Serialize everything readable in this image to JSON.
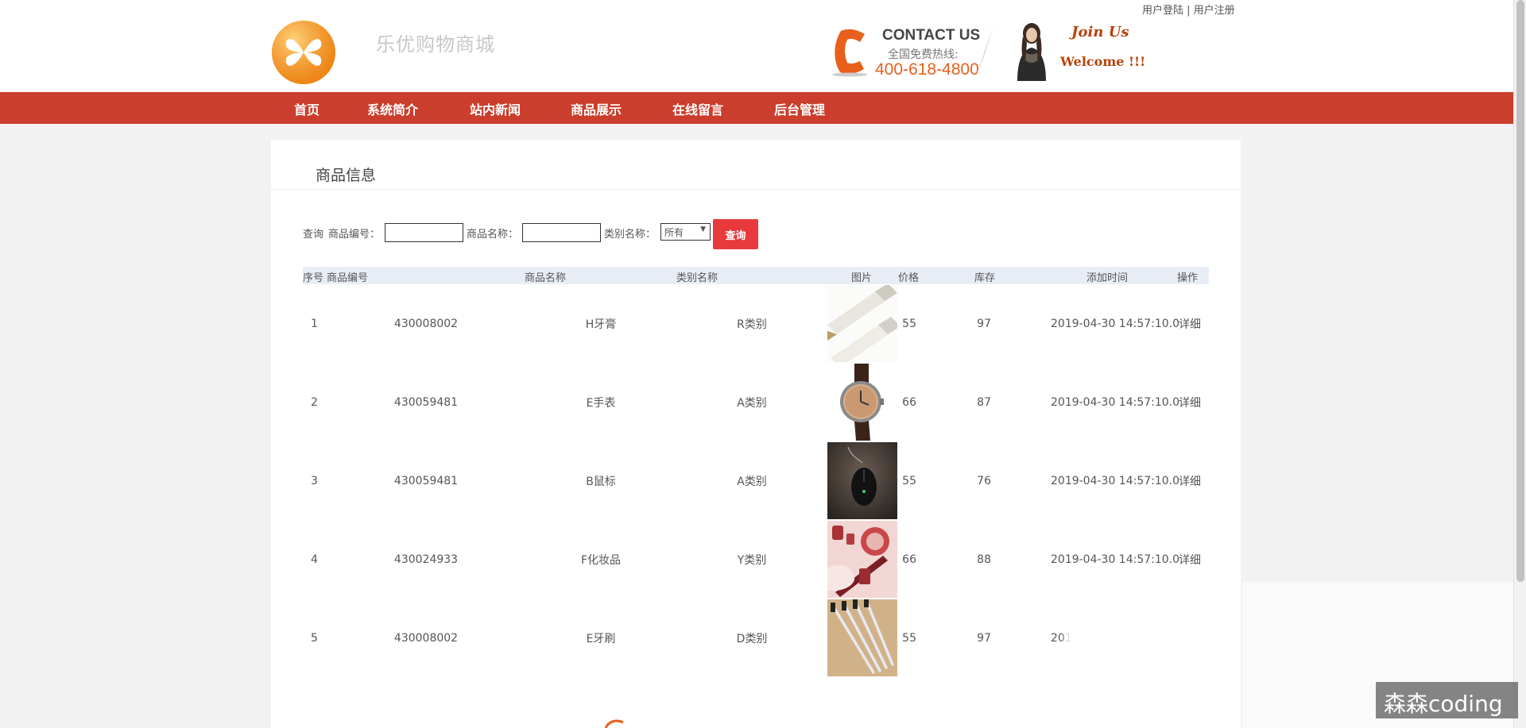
{
  "header": {
    "top_links": {
      "login": "用户登陆",
      "separator": " | ",
      "register": "用户注册"
    },
    "site_name": "乐优购物商城",
    "contact": {
      "title": "CONTACT US",
      "subtitle": "全国免费热线:",
      "phone": "400-618-4800"
    },
    "join_us": "Join Us",
    "welcome": "Welcome !!!"
  },
  "nav": {
    "items": [
      {
        "label": "首页"
      },
      {
        "label": "系统简介"
      },
      {
        "label": "站内新闻"
      },
      {
        "label": "商品展示"
      },
      {
        "label": "在线留言"
      },
      {
        "label": "后台管理"
      }
    ]
  },
  "main": {
    "title": "商品信息",
    "search": {
      "query_label": "查询",
      "code_label": "商品编号：",
      "code_value": "",
      "name_label": "商品名称：",
      "name_value": "",
      "category_label": "类别名称：",
      "category_selected": "所有",
      "button": "查询"
    },
    "table": {
      "headers": {
        "index": "序号",
        "code": "商品编号",
        "name": "商品名称",
        "category": "类别名称",
        "image": "图片",
        "price": "价格",
        "stock": "库存",
        "added": "添加时间",
        "action": "操作"
      },
      "rows": [
        {
          "index": "1",
          "code": "430008002",
          "name": "H牙膏",
          "category": "R类别",
          "image": "toothpaste",
          "price": "55",
          "stock": "97",
          "added": "2019-04-30 14:57:10.0",
          "action": "详细"
        },
        {
          "index": "2",
          "code": "430059481",
          "name": "E手表",
          "category": "A类别",
          "image": "watch",
          "price": "66",
          "stock": "87",
          "added": "2019-04-30 14:57:10.0",
          "action": "详细"
        },
        {
          "index": "3",
          "code": "430059481",
          "name": "B鼠标",
          "category": "A类别",
          "image": "mouse",
          "price": "55",
          "stock": "76",
          "added": "2019-04-30 14:57:10.0",
          "action": "详细"
        },
        {
          "index": "4",
          "code": "430024933",
          "name": "F化妆品",
          "category": "Y类别",
          "image": "cosmetics",
          "price": "66",
          "stock": "88",
          "added": "2019-04-30 14:57:10.0",
          "action": "详细"
        },
        {
          "index": "5",
          "code": "430008002",
          "name": "E牙刷",
          "category": "D类别",
          "image": "toothbrush",
          "price": "55",
          "stock": "97",
          "added": "201",
          "action": ""
        }
      ]
    }
  },
  "watermark": "森森coding",
  "colors": {
    "nav": "#cb3d2c",
    "search_button": "#e8393d",
    "phone": "#e8601c",
    "table_header": "#e8edf5"
  }
}
